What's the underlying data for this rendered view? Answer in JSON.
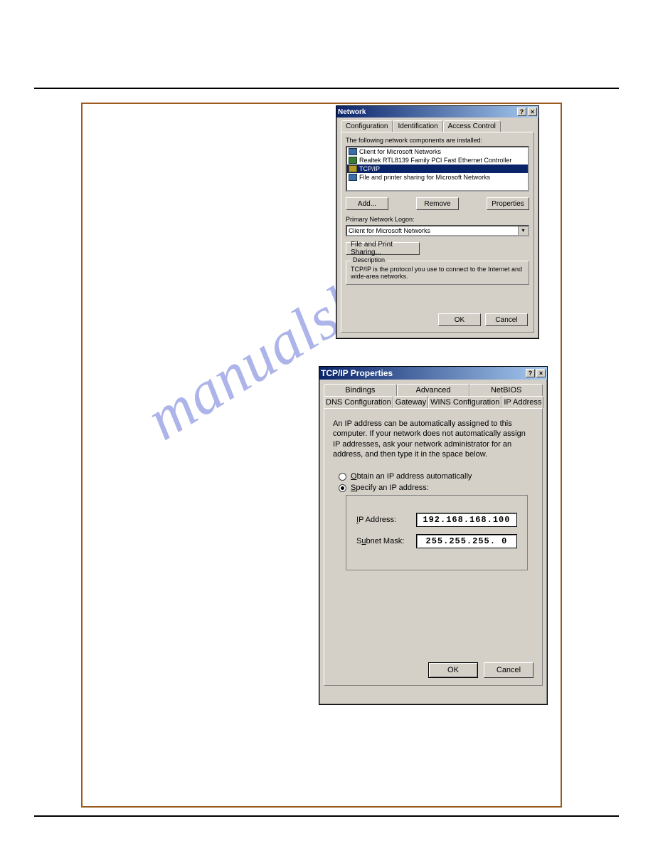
{
  "watermark": "manualshive.com",
  "network_dialog": {
    "title": "Network",
    "help_btn": "?",
    "close_btn": "×",
    "tabs": [
      "Configuration",
      "Identification",
      "Access Control"
    ],
    "components_label": "The following network components are installed:",
    "components": [
      "Client for Microsoft Networks",
      "Realtek RTL8139 Family PCI Fast Ethernet Controller",
      "TCP/IP",
      "File and printer sharing for Microsoft Networks"
    ],
    "add_btn": "Add...",
    "remove_btn": "Remove",
    "properties_btn": "Properties",
    "logon_label": "Primary Network Logon:",
    "logon_value": "Client for Microsoft Networks",
    "file_print_btn": "File and Print Sharing...",
    "description_legend": "Description",
    "description_text": "TCP/IP is the protocol you use to connect to the Internet and wide-area networks.",
    "ok_btn": "OK",
    "cancel_btn": "Cancel"
  },
  "tcpip_dialog": {
    "title": "TCP/IP Properties",
    "help_btn": "?",
    "close_btn": "×",
    "tabs_row1": [
      "Bindings",
      "Advanced",
      "NetBIOS"
    ],
    "tabs_row2": [
      "DNS Configuration",
      "Gateway",
      "WINS Configuration",
      "IP Address"
    ],
    "instructions": "An IP address can be automatically assigned to this computer. If your network does not automatically assign IP addresses, ask your network administrator for an address, and then type it in the space below.",
    "radio_auto": "Obtain an IP address automatically",
    "radio_specify": "Specify an IP address:",
    "ip_label": "IP Address:",
    "ip_value": "192.168.168.100",
    "subnet_label": "Subnet Mask:",
    "subnet_value": "255.255.255.  0",
    "ok_btn": "OK",
    "cancel_btn": "Cancel"
  }
}
